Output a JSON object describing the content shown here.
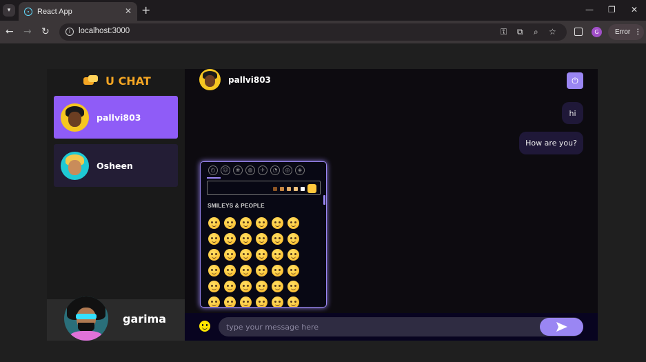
{
  "browser": {
    "tab_title": "React App",
    "url": "localhost:3000",
    "profile_initial": "G",
    "error_label": "Error"
  },
  "app": {
    "brand": "U CHAT",
    "contacts": [
      {
        "name": "pallvi803",
        "selected": true
      },
      {
        "name": "Osheen",
        "selected": false
      }
    ],
    "current_user": {
      "name": "garima"
    }
  },
  "chat": {
    "header_name": "pallvi803",
    "messages": [
      {
        "text": "hi",
        "sender": "me"
      },
      {
        "text": "How are you?",
        "sender": "me"
      }
    ],
    "input_placeholder": "type your message here"
  },
  "emoji_picker": {
    "section_label": "SMILEYS & PEOPLE",
    "skin_tones": [
      "#8d5524",
      "#c68642",
      "#e0ac69",
      "#f1c27d",
      "#ffffff",
      "#ffc83d"
    ],
    "emoji_count": 36
  },
  "colors": {
    "accent": "#9a86f3",
    "active_contact": "#8f5cf7",
    "brand": "#f5a623"
  }
}
